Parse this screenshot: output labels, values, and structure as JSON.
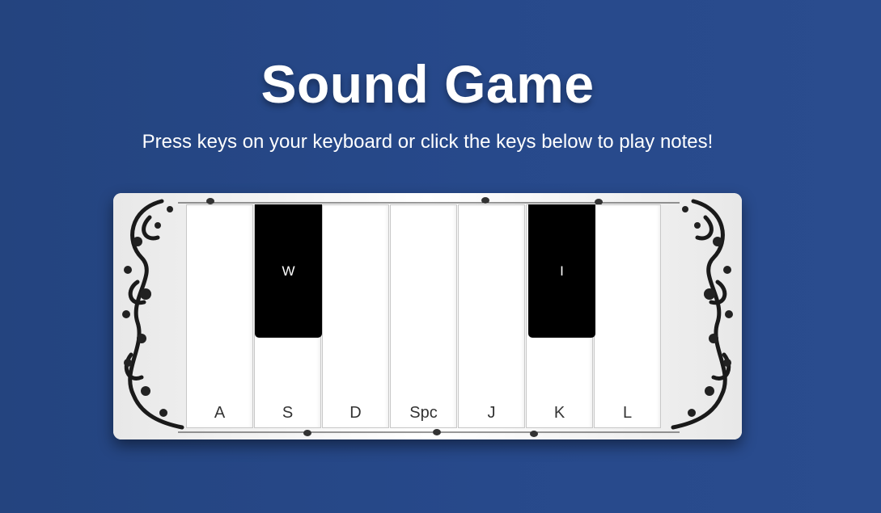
{
  "page": {
    "title": "Sound Game",
    "subtitle": "Press keys on your keyboard or click the keys below to play notes!"
  },
  "piano": {
    "white_keys": [
      {
        "label": "A"
      },
      {
        "label": "S"
      },
      {
        "label": "D"
      },
      {
        "label": "Spc"
      },
      {
        "label": "J"
      },
      {
        "label": "K"
      },
      {
        "label": "L"
      }
    ],
    "black_keys": [
      {
        "label": "W"
      },
      {
        "label": "I"
      }
    ]
  },
  "colors": {
    "background": "#264a8a",
    "white_key": "#ffffff",
    "black_key": "#000000"
  }
}
